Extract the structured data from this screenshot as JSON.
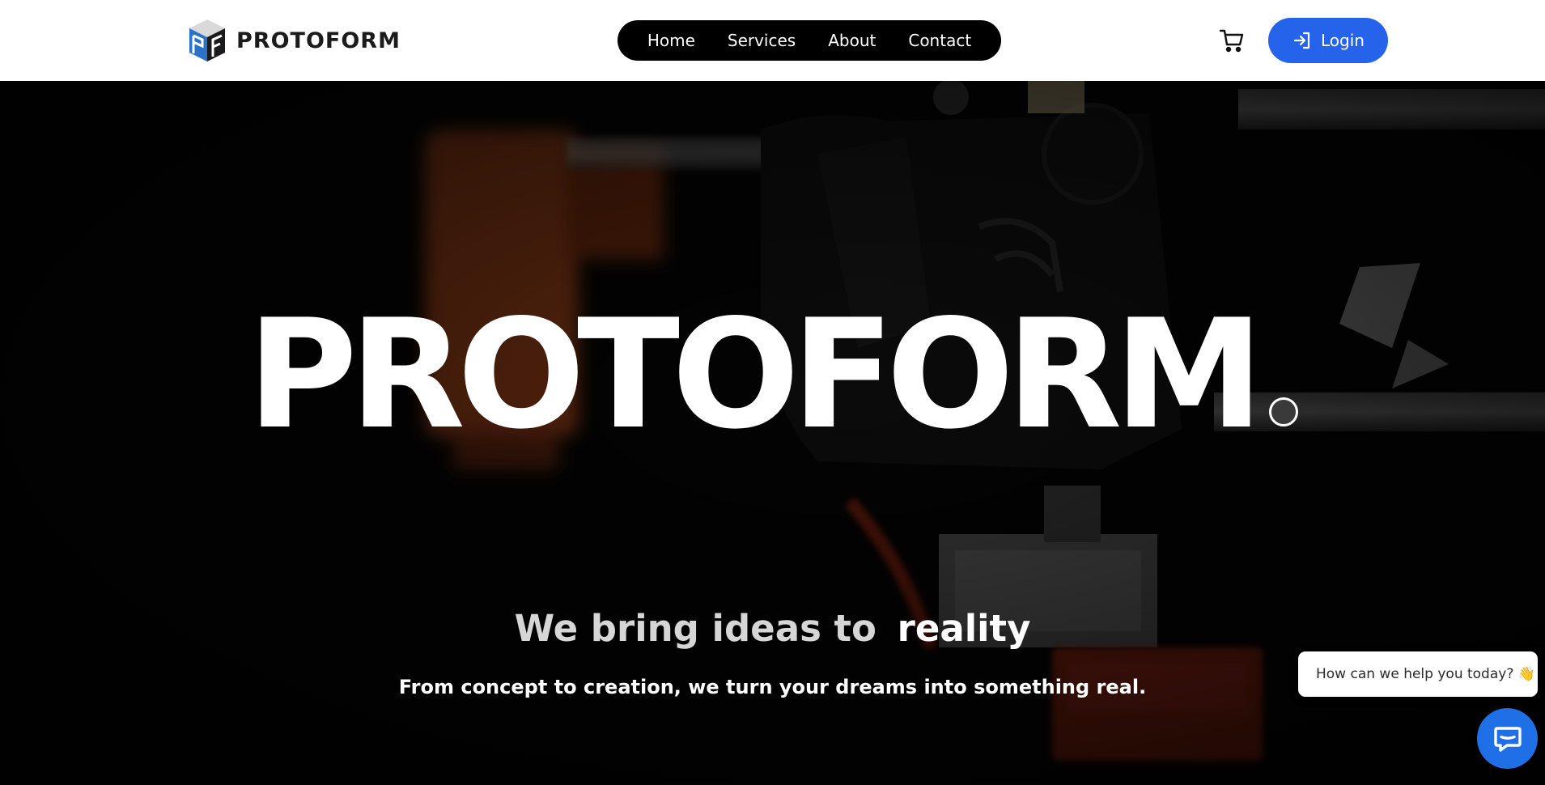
{
  "brand": {
    "name": "PROTOFORM",
    "logo_icon": "pf-cube-logo-icon",
    "accent_color": "#2563eb"
  },
  "nav": {
    "items": [
      {
        "label": "Home"
      },
      {
        "label": "Services"
      },
      {
        "label": "About"
      },
      {
        "label": "Contact"
      }
    ]
  },
  "header_actions": {
    "cart_icon": "shopping-cart-icon",
    "login_label": "Login",
    "login_icon": "sign-in-icon"
  },
  "hero": {
    "background": "dark photo of a 3D printer extruder",
    "title": "PROTOFORM",
    "tagline_prefix": "We bring ideas to",
    "tagline_accent": "reality",
    "subtitle": "From concept to creation, we turn your dreams into something real."
  },
  "chat": {
    "bubble_text": "How can we help you today? 👋",
    "button_icon": "chat-message-icon",
    "button_color": "#1f6fe6"
  }
}
